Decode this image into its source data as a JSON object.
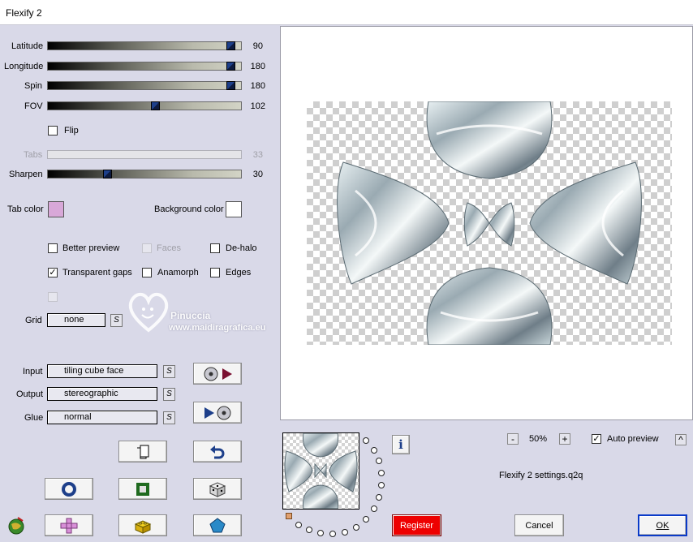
{
  "window": {
    "title": "Flexify 2"
  },
  "sliders": [
    {
      "id": "latitude",
      "label": "Latitude",
      "value": "90",
      "level": 0.97
    },
    {
      "id": "longitude",
      "label": "Longitude",
      "value": "180",
      "level": 0.97
    },
    {
      "id": "spin",
      "label": "Spin",
      "value": "180",
      "level": 0.97
    },
    {
      "id": "fov",
      "label": "FOV",
      "value": "102",
      "level": 0.56
    },
    {
      "id": "tabs",
      "label": "Tabs",
      "value": "33",
      "level": null
    },
    {
      "id": "sharpen",
      "label": "Sharpen",
      "value": "30",
      "level": 0.3
    }
  ],
  "flip": {
    "label": "Flip",
    "checked": false
  },
  "colors": {
    "tab_label": "Tab color",
    "tab_color": "#d8a8d8",
    "bg_label": "Background color",
    "bg_color": "#ffffff"
  },
  "options": {
    "better_preview": {
      "label": "Better preview",
      "checked": false
    },
    "faces": {
      "label": "Faces",
      "checked": false,
      "disabled": true
    },
    "de_halo": {
      "label": "De-halo",
      "checked": false
    },
    "transparent_gaps": {
      "label": "Transparent gaps",
      "checked": true
    },
    "anamorph": {
      "label": "Anamorph",
      "checked": false
    },
    "edges": {
      "label": "Edges",
      "checked": false
    }
  },
  "grid": {
    "label": "Grid",
    "value": "none",
    "s": "S"
  },
  "input": {
    "label": "Input",
    "value": "tiling cube face",
    "s": "S"
  },
  "output": {
    "label": "Output",
    "value": "stereographic",
    "s": "S"
  },
  "glue": {
    "label": "Glue",
    "value": "normal",
    "s": "S"
  },
  "watermark": {
    "line1": "Pinuccia",
    "line2": "www.maidiragrafica.eu"
  },
  "zoom": {
    "minus": "-",
    "value": "50%",
    "plus": "+"
  },
  "auto_preview": {
    "label": "Auto preview",
    "checked": true,
    "arrow": "^"
  },
  "settings_file": "Flexify 2 settings.q2q",
  "buttons": {
    "register": "Register",
    "cancel": "Cancel",
    "ok": "OK",
    "info": "i"
  },
  "accent": {
    "register_bg": "#ee0000",
    "thumb": "#1d3f8a"
  }
}
